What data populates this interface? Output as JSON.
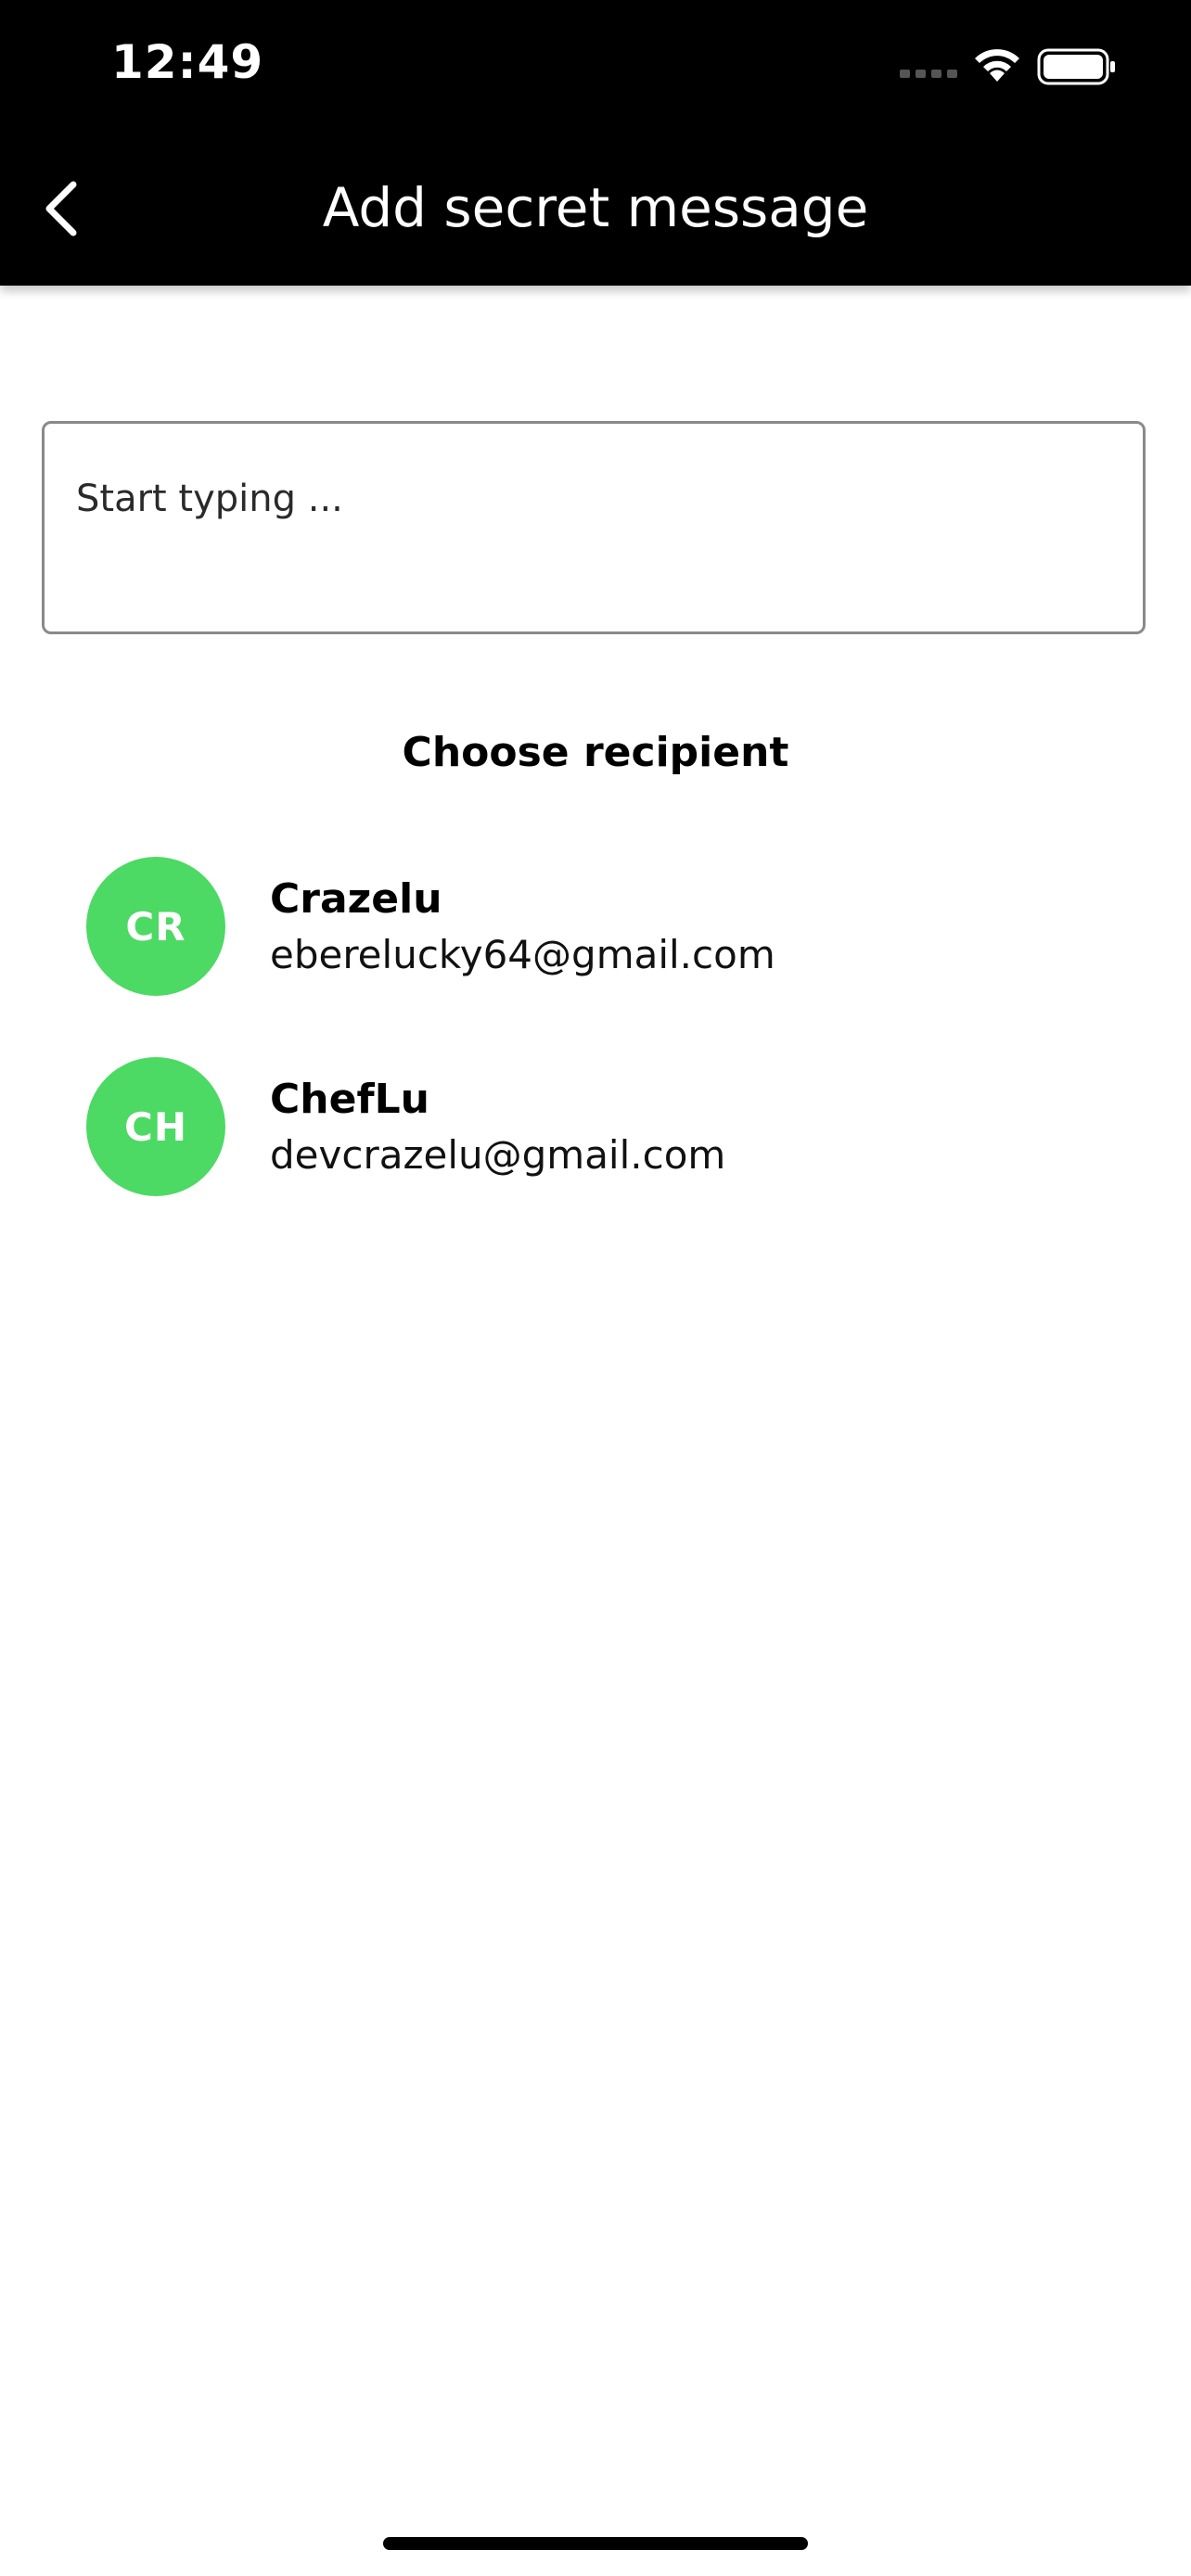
{
  "status_bar": {
    "time": "12:49",
    "icons": [
      "signal-icon",
      "wifi-icon",
      "battery-icon"
    ]
  },
  "nav": {
    "back_icon": "chevron-left-icon",
    "title": "Add secret message"
  },
  "message_input": {
    "placeholder": "Start typing ...",
    "value": ""
  },
  "recipients": {
    "heading": "Choose recipient",
    "items": [
      {
        "initials": "CR",
        "name": "Crazelu",
        "email": "eberelucky64@gmail.com"
      },
      {
        "initials": "CH",
        "name": "ChefLu",
        "email": "devcrazelu@gmail.com"
      }
    ]
  },
  "colors": {
    "header_bg": "#000000",
    "avatar_bg": "#4cd964",
    "border": "#8a8a8a"
  }
}
